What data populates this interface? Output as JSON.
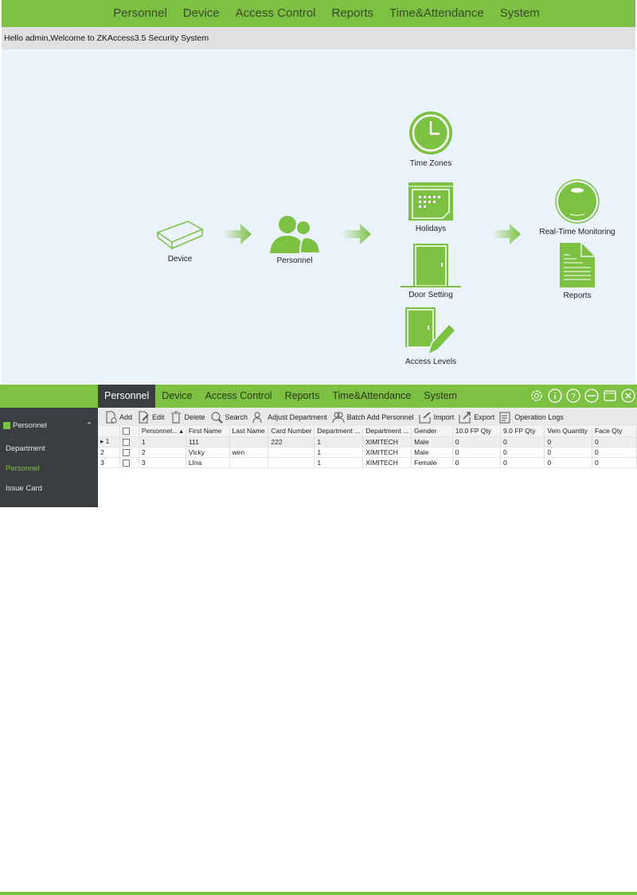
{
  "top_nav": [
    "Personnel",
    "Device",
    "Access Control",
    "Reports",
    "Time&Attendance",
    "System"
  ],
  "welcome": "Hello admin,Welcome to ZKAccess3.5 Security System",
  "flow": {
    "device": "Device",
    "personnel": "Personnel",
    "time_zones": "Time Zones",
    "holidays": "Holidays",
    "door_setting": "Door Setting",
    "access_levels": "Access Levels",
    "monitoring": "Real-Time Monitoring",
    "reports": "Reports"
  },
  "app": {
    "tabs": [
      "Personnel",
      "Device",
      "Access Control",
      "Reports",
      "Time&Attendance",
      "System"
    ],
    "active_tab": "Personnel",
    "header_icons": [
      "gear-icon",
      "info-icon",
      "help-icon",
      "minimize-icon",
      "maximize-icon",
      "close-icon"
    ],
    "sidebar": {
      "header": "Personnel",
      "items": [
        "Department",
        "Personnel",
        "Issue Card"
      ],
      "active": "Personnel"
    },
    "toolbar": [
      "Add",
      "Edit",
      "Delete",
      "Search",
      "Adjust Department",
      "Batch Add Personnel",
      "Import",
      "Export",
      "Operation Logs"
    ],
    "columns": [
      "Personnel...",
      "First Name",
      "Last Name",
      "Card Number",
      "Department ...",
      "Department ...",
      "Gender",
      "10.0 FP Qty",
      "9.0 FP Qty",
      "Vein Quantity",
      "Face Qty"
    ],
    "rows": [
      {
        "n": "1",
        "cells": [
          "1",
          "111",
          "",
          "222",
          "1",
          "XIMITECH",
          "Male",
          "0",
          "0",
          "0",
          "0"
        ]
      },
      {
        "n": "2",
        "cells": [
          "2",
          "Vicky",
          "wen",
          "",
          "1",
          "XIMITECH",
          "Male",
          "0",
          "0",
          "0",
          "0"
        ]
      },
      {
        "n": "3",
        "cells": [
          "3",
          "LIna",
          "",
          "",
          "1",
          "XIMITECH",
          "Female",
          "0",
          "0",
          "0",
          "0"
        ]
      }
    ]
  },
  "colors": {
    "accent": "#7cc142",
    "dark": "#3b3e41",
    "canvas": "#eaf2fc"
  }
}
